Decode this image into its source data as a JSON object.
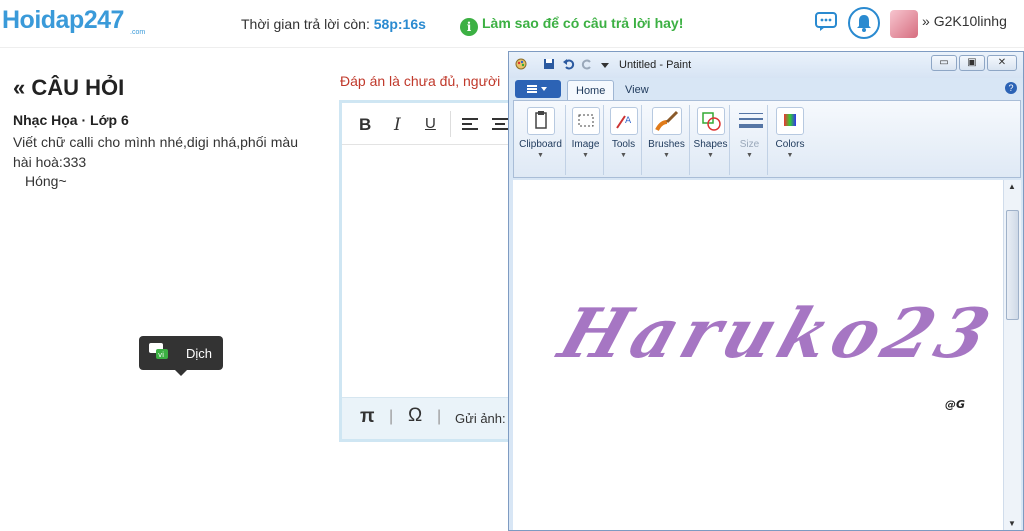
{
  "header": {
    "logo_text": "Hoidap247",
    "logo_sub": ".com",
    "timer_label": "Thời gian trả lời còn:",
    "timer_value": "58p:16s",
    "tip_text": "Làm sao để có câu trả lời hay!",
    "username": "G2K10linhg",
    "icons": [
      "chat-icon",
      "bell-icon",
      "avatar"
    ]
  },
  "question": {
    "title": "« CÂU HỎI",
    "meta": "Nhạc Họa · Lớp 6",
    "body": "Viết chữ calli cho mình nhé,digi nhá,phối màu hài hoà:333",
    "sign": "Hóng~"
  },
  "tooltip": {
    "label": "Dịch",
    "icon_text": "vi"
  },
  "editor": {
    "warning": "Đáp án là chưa đủ, người",
    "toolbar": [
      "B",
      "I",
      "U"
    ],
    "footer": {
      "pi": "π",
      "omega": "Ω",
      "upload": "Gửi ảnh:"
    }
  },
  "paint": {
    "title": "Untitled - Paint",
    "tabs": [
      "Home",
      "View"
    ],
    "active_tab": "Home",
    "ribbon_groups": [
      "Clipboard",
      "Image",
      "Tools",
      "Brushes",
      "Shapes",
      "Size",
      "Colors"
    ],
    "artwork_text": "Haruko23",
    "artwork_tag": "@G",
    "colors": {
      "artwork": "#9d68bd"
    }
  }
}
